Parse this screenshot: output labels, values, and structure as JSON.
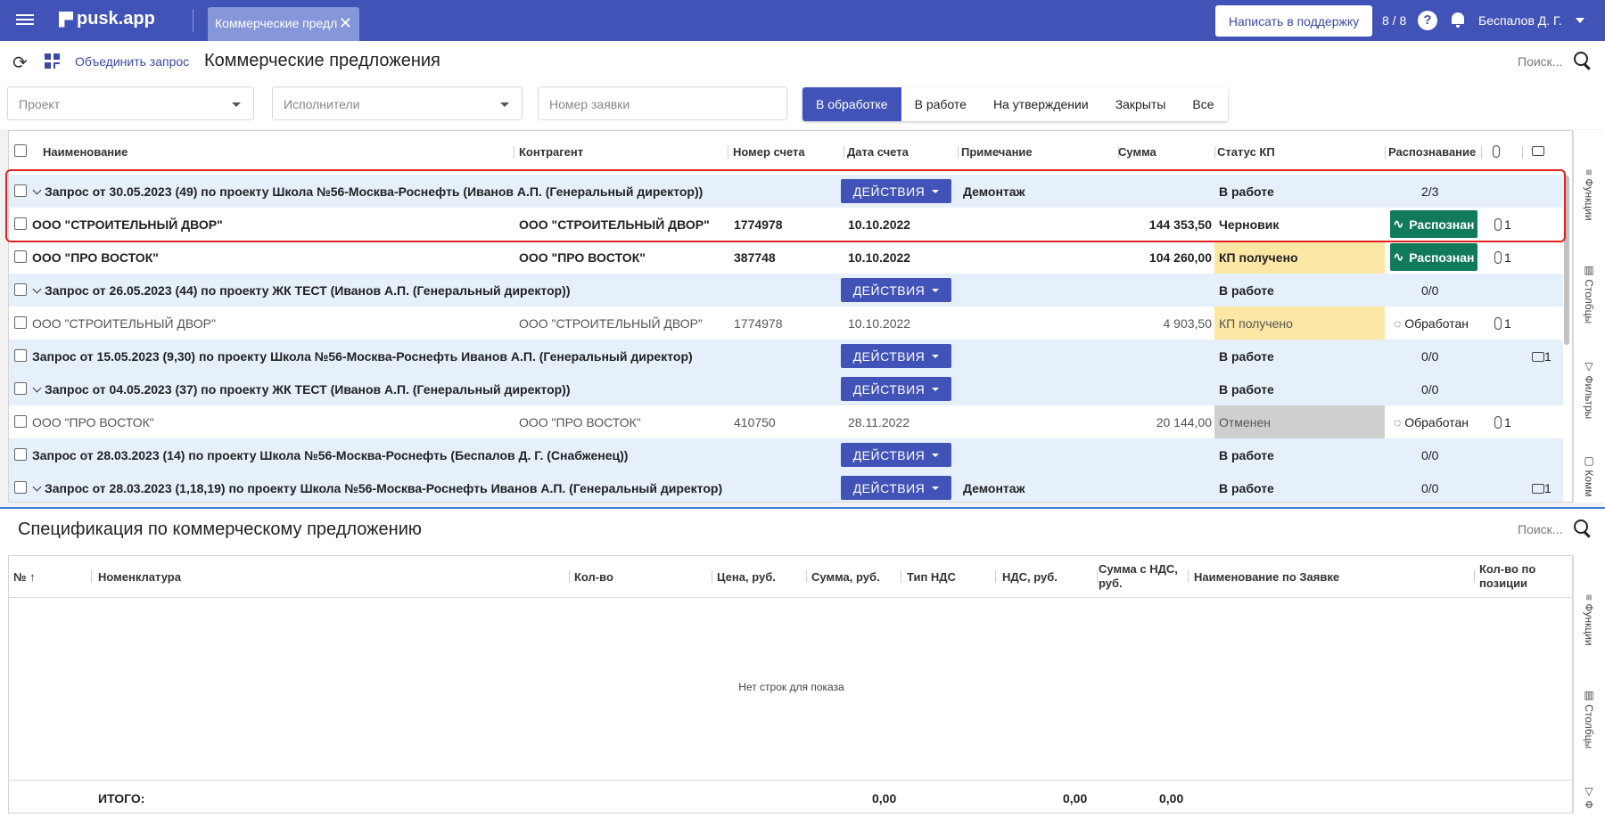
{
  "header": {
    "logo": "pusk.app",
    "tab_label": "Коммерческие предл",
    "support_button": "Написать в поддержку",
    "counter": "8 / 8",
    "help": "?",
    "user_name": "Беспалов Д. Г."
  },
  "toolbar": {
    "merge_label": "Объединить запрос",
    "page_title": "Коммерческие предложения",
    "search_placeholder": "Поиск..."
  },
  "filters": {
    "project_placeholder": "Проект",
    "executors_placeholder": "Исполнители",
    "request_number_placeholder": "Номер заявки",
    "status_tabs": [
      "В обработке",
      "В работе",
      "На утверждении",
      "Закрыты",
      "Все"
    ],
    "active_tab": "В обработке"
  },
  "grid": {
    "columns": [
      "Наименование",
      "Контрагент",
      "Номер счета",
      "Дата счета",
      "Примечание",
      "Сумма",
      "Статус КП",
      "Распознавание"
    ],
    "actions_label": "ДЕЙСТВИЯ",
    "rows": [
      {
        "type": "group",
        "name": "Запрос от 30.05.2023 (49) по проекту Школа №56-Москва-Роснефть (Иванов А.П. (Генеральный директор))",
        "note": "Демонтаж",
        "status": "В работе",
        "recognition": "2/3"
      },
      {
        "type": "item",
        "name": "ООО \"СТРОИТЕЛЬНЫЙ ДВОР\"",
        "contractor": "ООО \"СТРОИТЕЛЬНЫЙ ДВОР\"",
        "invoice": "1774978",
        "date": "10.10.2022",
        "sum": "144 353,50",
        "status": "Черновик",
        "recognition": "Распознан",
        "attach": "1"
      },
      {
        "type": "item",
        "name": "ООО \"ПРО ВОСТОК\"",
        "contractor": "ООО \"ПРО ВОСТОК\"",
        "invoice": "387748",
        "date": "10.10.2022",
        "sum": "104 260,00",
        "status": "КП получено",
        "recognition": "Распознан",
        "attach": "1"
      },
      {
        "type": "group",
        "name": "Запрос от 26.05.2023 (44) по проекту ЖК ТЕСТ (Иванов А.П. (Генеральный директор))",
        "status": "В работе",
        "recognition": "0/0"
      },
      {
        "type": "item",
        "name": "ООО \"СТРОИТЕЛЬНЫЙ ДВОР\"",
        "contractor": "ООО \"СТРОИТЕЛЬНЫЙ ДВОР\"",
        "invoice": "1774978",
        "date": "10.10.2022",
        "sum": "4 903,50",
        "status": "КП получено",
        "recognition": "Обработан",
        "attach": "1"
      },
      {
        "type": "group",
        "name": "Запрос от 15.05.2023 (9,30) по проекту Школа №56-Москва-Роснефть Иванов А.П. (Генеральный директор)",
        "status": "В работе",
        "recognition": "0/0",
        "comments": "1"
      },
      {
        "type": "group",
        "name": "Запрос от 04.05.2023 (37) по проекту ЖК ТЕСТ (Иванов А.П. (Генеральный директор))",
        "status": "В работе",
        "recognition": "0/0"
      },
      {
        "type": "item",
        "name": "ООО \"ПРО ВОСТОК\"",
        "contractor": "ООО \"ПРО ВОСТОК\"",
        "invoice": "410750",
        "date": "28.11.2022",
        "sum": "20 144,00",
        "status": "Отменен",
        "recognition": "Обработан",
        "attach": "1"
      },
      {
        "type": "group",
        "name": "Запрос от 28.03.2023 (14) по проекту Школа №56-Москва-Роснефть (Беспалов Д. Г. (Снабженец))",
        "status": "В работе",
        "recognition": "0/0"
      },
      {
        "type": "group",
        "name": "Запрос от 28.03.2023 (1,18,19) по проекту Школа №56-Москва-Роснефть Иванов А.П. (Генеральный директор)",
        "note": "Демонтаж",
        "status": "В работе",
        "recognition": "0/0",
        "comments": "1"
      }
    ]
  },
  "side_rail": {
    "functions": "Функции",
    "columns": "Столбцы",
    "filters": "Фильтры",
    "comments": "Комм"
  },
  "spec": {
    "title": "Спецификация по коммерческому предложению",
    "search_placeholder": "Поиск...",
    "columns": [
      "№",
      "Номенклатура",
      "Кол-во",
      "Цена, руб.",
      "Сумма, руб.",
      "Тип НДС",
      "НДС, руб.",
      "Сумма с НДС, руб.",
      "Наименование по Заявке",
      "Кол-во по позиции"
    ],
    "empty_text": "Нет строк для показа",
    "total_label": "ИТОГО:",
    "total_sum": "0,00",
    "total_vat": "0,00",
    "total_with_vat": "0,00",
    "side_functions": "Функции",
    "side_columns": "Столбцы",
    "side_filters": "Ф"
  },
  "colors": {
    "primary": "#4253b8",
    "recognized": "#117a5a",
    "status_received": "#fde7a4",
    "status_cancelled": "#cfcfcf",
    "group_row": "#e6f0fb",
    "highlight": "#e02020"
  }
}
